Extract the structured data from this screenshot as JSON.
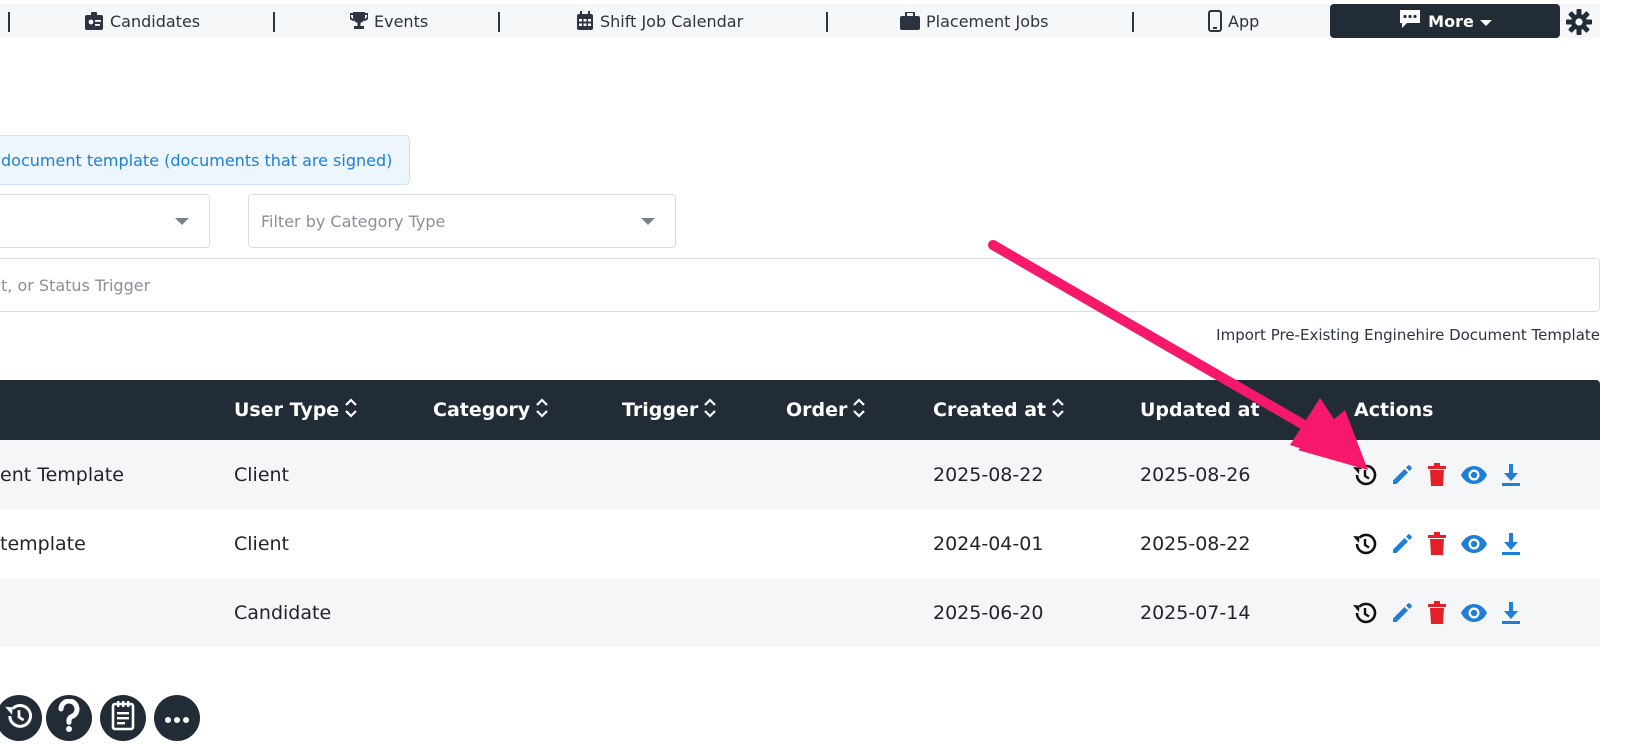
{
  "nav": {
    "items": [
      {
        "label": "Candidates",
        "icon": "id-card-icon"
      },
      {
        "label": "Events",
        "icon": "trophy-icon"
      },
      {
        "label": "Shift Job Calendar",
        "icon": "calendar-icon"
      },
      {
        "label": "Placement Jobs",
        "icon": "briefcase-icon"
      },
      {
        "label": "App",
        "icon": "mobile-icon"
      }
    ],
    "more_label": "More",
    "settings_icon": "gear-icon"
  },
  "toolbar": {
    "doc_button_label": "document template (documents that are signed)"
  },
  "filters": {
    "first_select_value": "",
    "category_placeholder": "Filter by Category Type",
    "search_placeholder": "t, or Status Trigger",
    "import_link": "Import Pre-Existing Enginehire Document Template"
  },
  "table": {
    "columns": [
      {
        "label": "User Type",
        "sortable": true
      },
      {
        "label": "Category",
        "sortable": true
      },
      {
        "label": "Trigger",
        "sortable": true
      },
      {
        "label": "Order",
        "sortable": true
      },
      {
        "label": "Created at",
        "sortable": true
      },
      {
        "label": "Updated at",
        "sortable": false
      },
      {
        "label": "Actions",
        "sortable": false
      }
    ],
    "rows": [
      {
        "name": "ent Template",
        "user_type": "Client",
        "category": "",
        "trigger": "",
        "order": "",
        "created": "2025-08-22",
        "updated": "2025-08-26"
      },
      {
        "name": " template",
        "user_type": "Client",
        "category": "",
        "trigger": "",
        "order": "",
        "created": "2024-04-01",
        "updated": "2025-08-22"
      },
      {
        "name": "",
        "user_type": "Candidate",
        "category": "",
        "trigger": "",
        "order": "",
        "created": "2025-06-20",
        "updated": "2025-07-14"
      }
    ],
    "action_icons": [
      "history-icon",
      "edit-pencil-icon",
      "trash-icon",
      "eye-icon",
      "download-icon"
    ]
  },
  "floating_buttons": [
    "history-icon",
    "help-question-icon",
    "notes-icon",
    "ellipsis-icon"
  ],
  "colors": {
    "dark": "#212c37",
    "accent_blue": "#1e7fd8",
    "danger_red": "#e3202a",
    "annotation_pink": "#f5186b"
  }
}
